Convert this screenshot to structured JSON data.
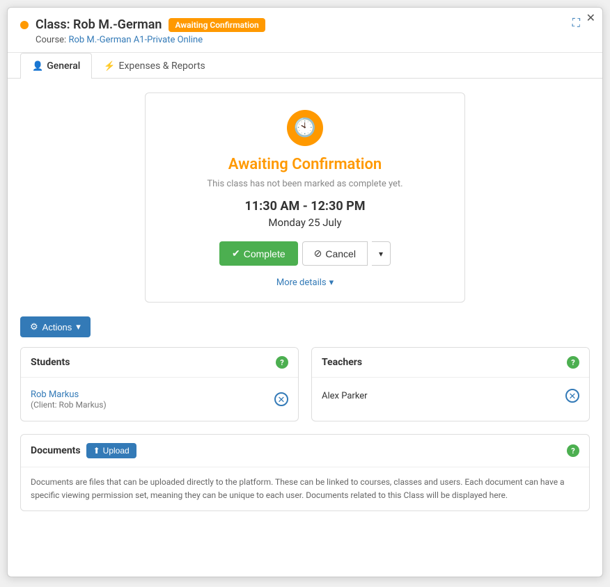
{
  "modal": {
    "close_label": "✕",
    "expand_label": "⛶"
  },
  "header": {
    "status_dot_color": "#f90",
    "title": "Class: Rob M.-German",
    "badge": "Awaiting Confirmation",
    "course_label": "Course:",
    "course_link_text": "Rob M.-German A1-Private Online"
  },
  "tabs": [
    {
      "id": "general",
      "icon": "👤",
      "label": "General",
      "active": true
    },
    {
      "id": "expenses",
      "icon": "⚡",
      "label": "Expenses & Reports",
      "active": false
    }
  ],
  "status_card": {
    "clock_icon": "🕙",
    "status_title": "Awaiting Confirmation",
    "status_sub": "This class has not been marked as complete yet.",
    "class_time": "11:30 AM - 12:30 PM",
    "class_date": "Monday 25 July",
    "btn_complete": "Complete",
    "btn_cancel": "Cancel",
    "btn_dropdown": "▾",
    "more_details": "More details",
    "more_details_icon": "▾"
  },
  "actions_bar": {
    "gear_icon": "⚙",
    "label": "Actions",
    "dropdown_icon": "▾"
  },
  "students_panel": {
    "title": "Students",
    "help_icon": "?",
    "student_name": "Rob Markus",
    "student_client": "(Client: Rob Markus)",
    "remove_icon": "✕"
  },
  "teachers_panel": {
    "title": "Teachers",
    "help_icon": "?",
    "teacher_name": "Alex Parker",
    "remove_icon": "✕"
  },
  "documents_panel": {
    "title": "Documents",
    "upload_icon": "⬆",
    "upload_label": "Upload",
    "help_icon": "?",
    "description": "Documents are files that can be uploaded directly to the platform. These can be linked to courses, classes and users. Each document can have a specific viewing permission set, meaning they can be unique to each user. Documents related to this Class will be displayed here."
  }
}
